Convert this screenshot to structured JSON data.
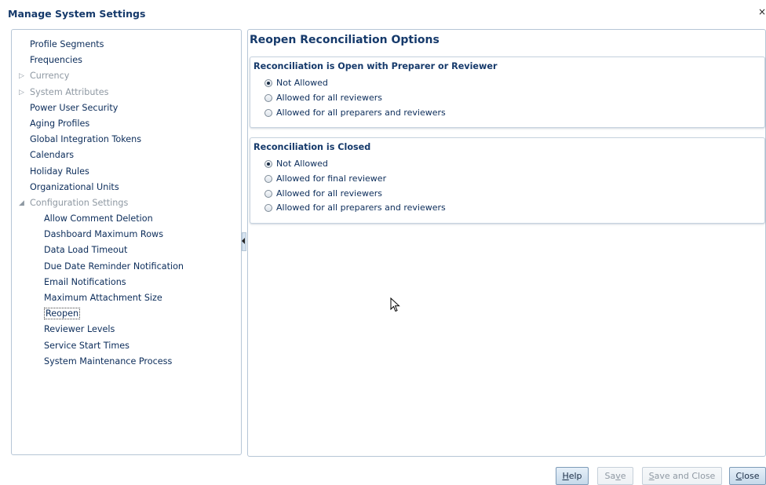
{
  "dialog": {
    "title": "Manage System Settings",
    "close_glyph": "×"
  },
  "tree": [
    {
      "label": "Profile Segments",
      "level": 0,
      "disabled": false
    },
    {
      "label": "Frequencies",
      "level": 0,
      "disabled": false
    },
    {
      "label": "Currency",
      "level": 0,
      "disabled": true,
      "expander": "▷"
    },
    {
      "label": "System Attributes",
      "level": 0,
      "disabled": true,
      "expander": "▷"
    },
    {
      "label": "Power User Security",
      "level": 0,
      "disabled": false
    },
    {
      "label": "Aging Profiles",
      "level": 0,
      "disabled": false
    },
    {
      "label": "Global Integration Tokens",
      "level": 0,
      "disabled": false
    },
    {
      "label": "Calendars",
      "level": 0,
      "disabled": false
    },
    {
      "label": "Holiday Rules",
      "level": 0,
      "disabled": false
    },
    {
      "label": "Organizational Units",
      "level": 0,
      "disabled": false
    },
    {
      "label": "Configuration Settings",
      "level": 0,
      "disabled": true,
      "expander": "◢"
    },
    {
      "label": "Allow Comment Deletion",
      "level": 1,
      "disabled": false
    },
    {
      "label": "Dashboard Maximum Rows",
      "level": 1,
      "disabled": false
    },
    {
      "label": "Data Load Timeout",
      "level": 1,
      "disabled": false
    },
    {
      "label": "Due Date Reminder Notification",
      "level": 1,
      "disabled": false
    },
    {
      "label": "Email Notifications",
      "level": 1,
      "disabled": false
    },
    {
      "label": "Maximum Attachment Size",
      "level": 1,
      "disabled": false
    },
    {
      "label": "Reopen",
      "level": 1,
      "disabled": false,
      "selected": true
    },
    {
      "label": "Reviewer Levels",
      "level": 1,
      "disabled": false
    },
    {
      "label": "Service Start Times",
      "level": 1,
      "disabled": false
    },
    {
      "label": "System Maintenance Process",
      "level": 1,
      "disabled": false
    }
  ],
  "main": {
    "title": "Reopen Reconciliation Options",
    "sections": [
      {
        "title": "Reconciliation is Open with Preparer or Reviewer",
        "options": [
          {
            "label": "Not Allowed",
            "checked": true
          },
          {
            "label": "Allowed for all reviewers",
            "checked": false
          },
          {
            "label": "Allowed for all preparers and reviewers",
            "checked": false
          }
        ]
      },
      {
        "title": "Reconciliation is Closed",
        "options": [
          {
            "label": "Not Allowed",
            "checked": true
          },
          {
            "label": "Allowed for final reviewer",
            "checked": false
          },
          {
            "label": "Allowed for all reviewers",
            "checked": false
          },
          {
            "label": "Allowed for all preparers and reviewers",
            "checked": false
          }
        ]
      }
    ]
  },
  "buttons": {
    "help": {
      "pre": "",
      "mnemonic": "H",
      "post": "elp"
    },
    "save": {
      "pre": "Sa",
      "mnemonic": "v",
      "post": "e"
    },
    "save_and_close": {
      "pre": "",
      "mnemonic": "S",
      "post": "ave and Close"
    },
    "close": {
      "pre": "",
      "mnemonic": "C",
      "post": "lose"
    }
  },
  "colors": {
    "accent": "#163a6b",
    "text": "#0b2c5a",
    "disabled_text": "#8f99a3",
    "border": "#b6c6d6"
  }
}
